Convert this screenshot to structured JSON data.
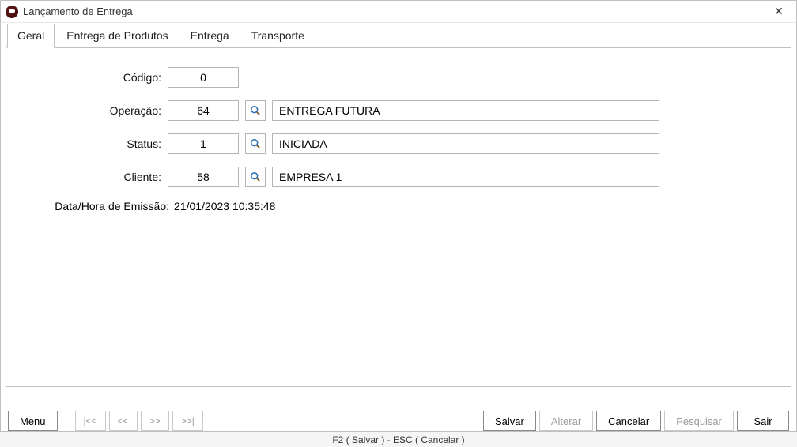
{
  "window": {
    "title": "Lançamento de Entrega"
  },
  "tabs": [
    {
      "label": "Geral",
      "active": true
    },
    {
      "label": "Entrega de Produtos",
      "active": false
    },
    {
      "label": "Entrega",
      "active": false
    },
    {
      "label": "Transporte",
      "active": false
    }
  ],
  "form": {
    "codigo": {
      "label": "Código:",
      "value": "0"
    },
    "operacao": {
      "label": "Operação:",
      "code": "64",
      "desc": "ENTREGA FUTURA"
    },
    "status": {
      "label": "Status:",
      "code": "1",
      "desc": "INICIADA"
    },
    "cliente": {
      "label": "Cliente:",
      "code": "58",
      "desc": "EMPRESA 1"
    },
    "emissao": {
      "label": "Data/Hora de Emissão:",
      "value": "21/01/2023 10:35:48"
    }
  },
  "footer": {
    "menu": "Menu",
    "first": "|<<",
    "prev": "<<",
    "next": ">>",
    "last": ">>|",
    "salvar": "Salvar",
    "alterar": "Alterar",
    "cancelar": "Cancelar",
    "pesquisar": "Pesquisar",
    "sair": "Sair"
  },
  "statusbar": "F2 ( Salvar )  -  ESC ( Cancelar )"
}
